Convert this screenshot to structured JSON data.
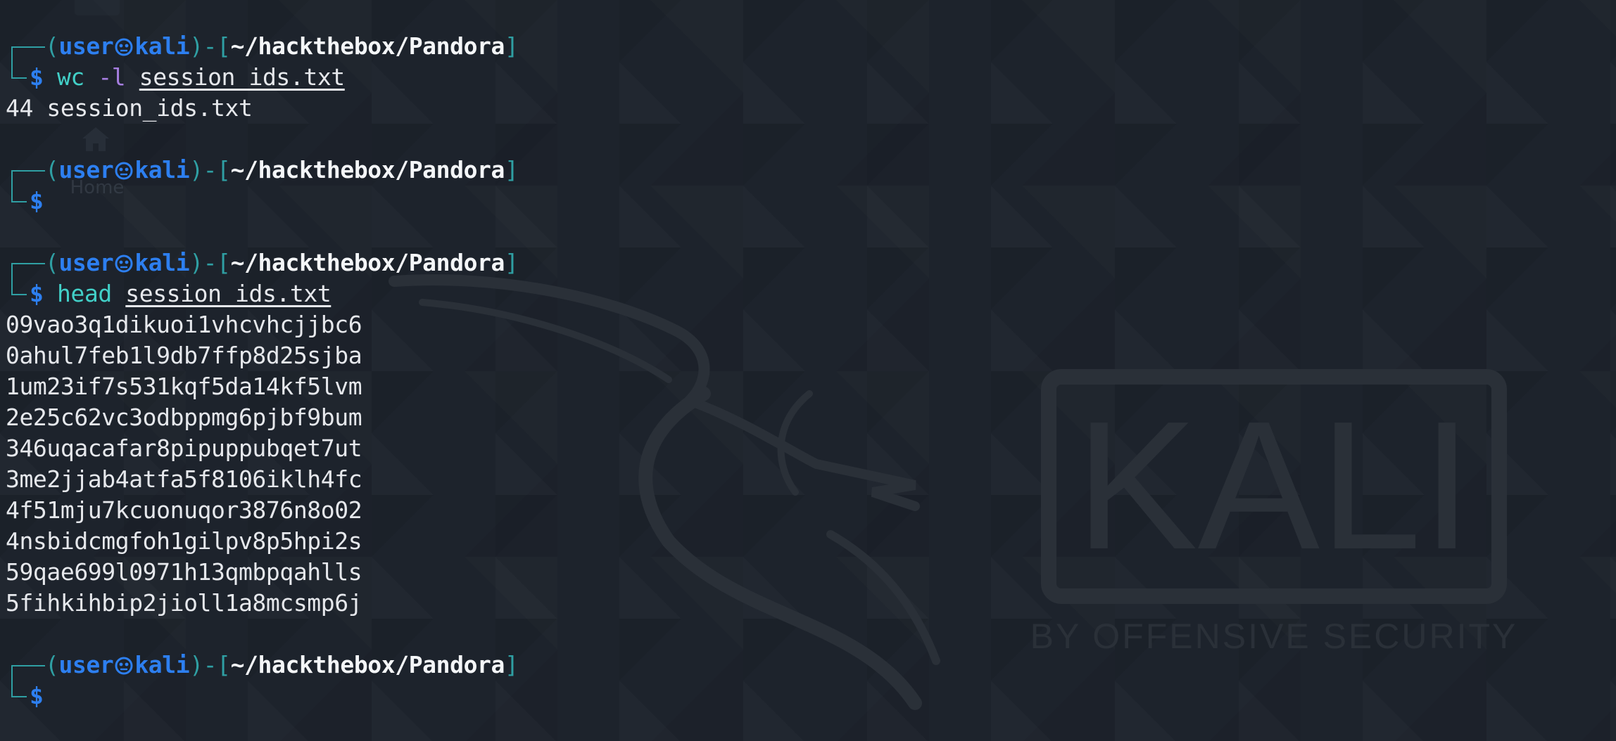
{
  "desktop": {
    "home_label": "Home"
  },
  "wallpaper": {
    "logo_text": "KALI",
    "tagline": "BY OFFENSIVE SECURITY"
  },
  "prompt": {
    "user": "user",
    "separator_icon": "skull-icon",
    "host": "kali",
    "path": "~/hackthebox/Pandora",
    "symbol": "$"
  },
  "blocks": [
    {
      "command": "wc",
      "flag": "-l",
      "argument": "session_ids.txt",
      "output": [
        "44 session_ids.txt"
      ]
    },
    {
      "command": "",
      "flag": "",
      "argument": "",
      "output": []
    },
    {
      "command": "head",
      "flag": "",
      "argument": "session_ids.txt",
      "output": [
        "09vao3q1dikuoi1vhcvhcjjbc6",
        "0ahul7feb1l9db7ffp8d25sjba",
        "1um23if7s531kqf5da14kf5lvm",
        "2e25c62vc3odbppmg6pjbf9bum",
        "346uqacafar8pipuppubqet7ut",
        "3me2jjab4atfa5f8106iklh4fc",
        "4f51mju7kcuonuqor3876n8o02",
        "4nsbidcmgfoh1gilpv8p5hpi2s",
        "59qae699l0971h13qmbpqahlls",
        "5fihkihbip2jioll1a8mcsmp6j"
      ]
    },
    {
      "command": "",
      "flag": "",
      "argument": "",
      "output": []
    }
  ],
  "colors": {
    "background": "#1c222b",
    "frame_teal": "#2f9fa3",
    "prompt_blue": "#2d7ff0",
    "command_cyan": "#42d0c8",
    "flag_purple": "#a67ee0",
    "text": "#e6e8ec"
  }
}
